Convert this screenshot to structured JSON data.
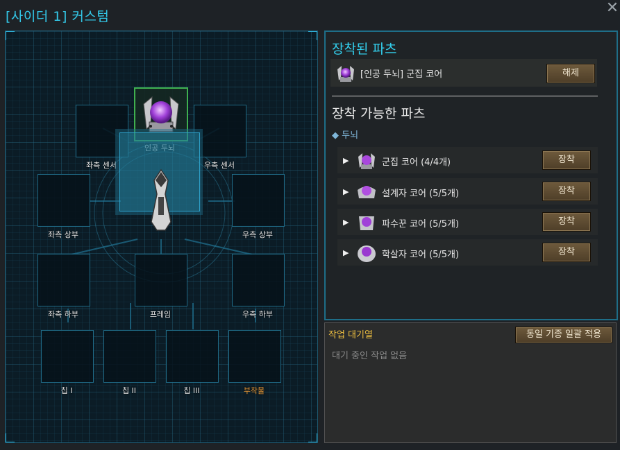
{
  "window": {
    "title": "[사이더 1] 커스텀",
    "close_symbol": "✕"
  },
  "slots": {
    "brain": "인공 두뇌",
    "left_sensor": "좌측 센서",
    "right_sensor": "우측 센서",
    "left_upper": "좌측 상부",
    "right_upper": "우측 상부",
    "left_lower": "좌측 하부",
    "frame": "프레임",
    "right_lower": "우측 하부",
    "chip1": "칩 I",
    "chip2": "칩 II",
    "chip3": "칩 III",
    "attachment": "부착물"
  },
  "equipped": {
    "title": "장착된 파츠",
    "item_name": "[인공 두뇌] 군집 코어",
    "unequip_label": "해제"
  },
  "available": {
    "title": "장착 가능한 파츠",
    "category": "◆ 두뇌",
    "items": [
      {
        "name": "군집 코어 (4/4개)",
        "button": "장착"
      },
      {
        "name": "설계자 코어 (5/5개)",
        "button": "장착"
      },
      {
        "name": "파수꾼 코어 (5/5개)",
        "button": "장착"
      },
      {
        "name": "학살자 코어 (5/5개)",
        "button": "장착"
      }
    ]
  },
  "queue": {
    "title": "작업 대기열",
    "apply_all_label": "동일 기종 일괄 적용",
    "empty_text": "대기 중인 작업 없음"
  },
  "colors": {
    "accent_cyan": "#33c8e8",
    "equipped_border": "#3fb04f",
    "queue_title": "#f0c040",
    "attachment_label": "#e89a3a"
  },
  "icons": {
    "core": "purple-orb-core-icon",
    "ship": "spaceship-icon",
    "expand": "triangle-right-icon"
  }
}
